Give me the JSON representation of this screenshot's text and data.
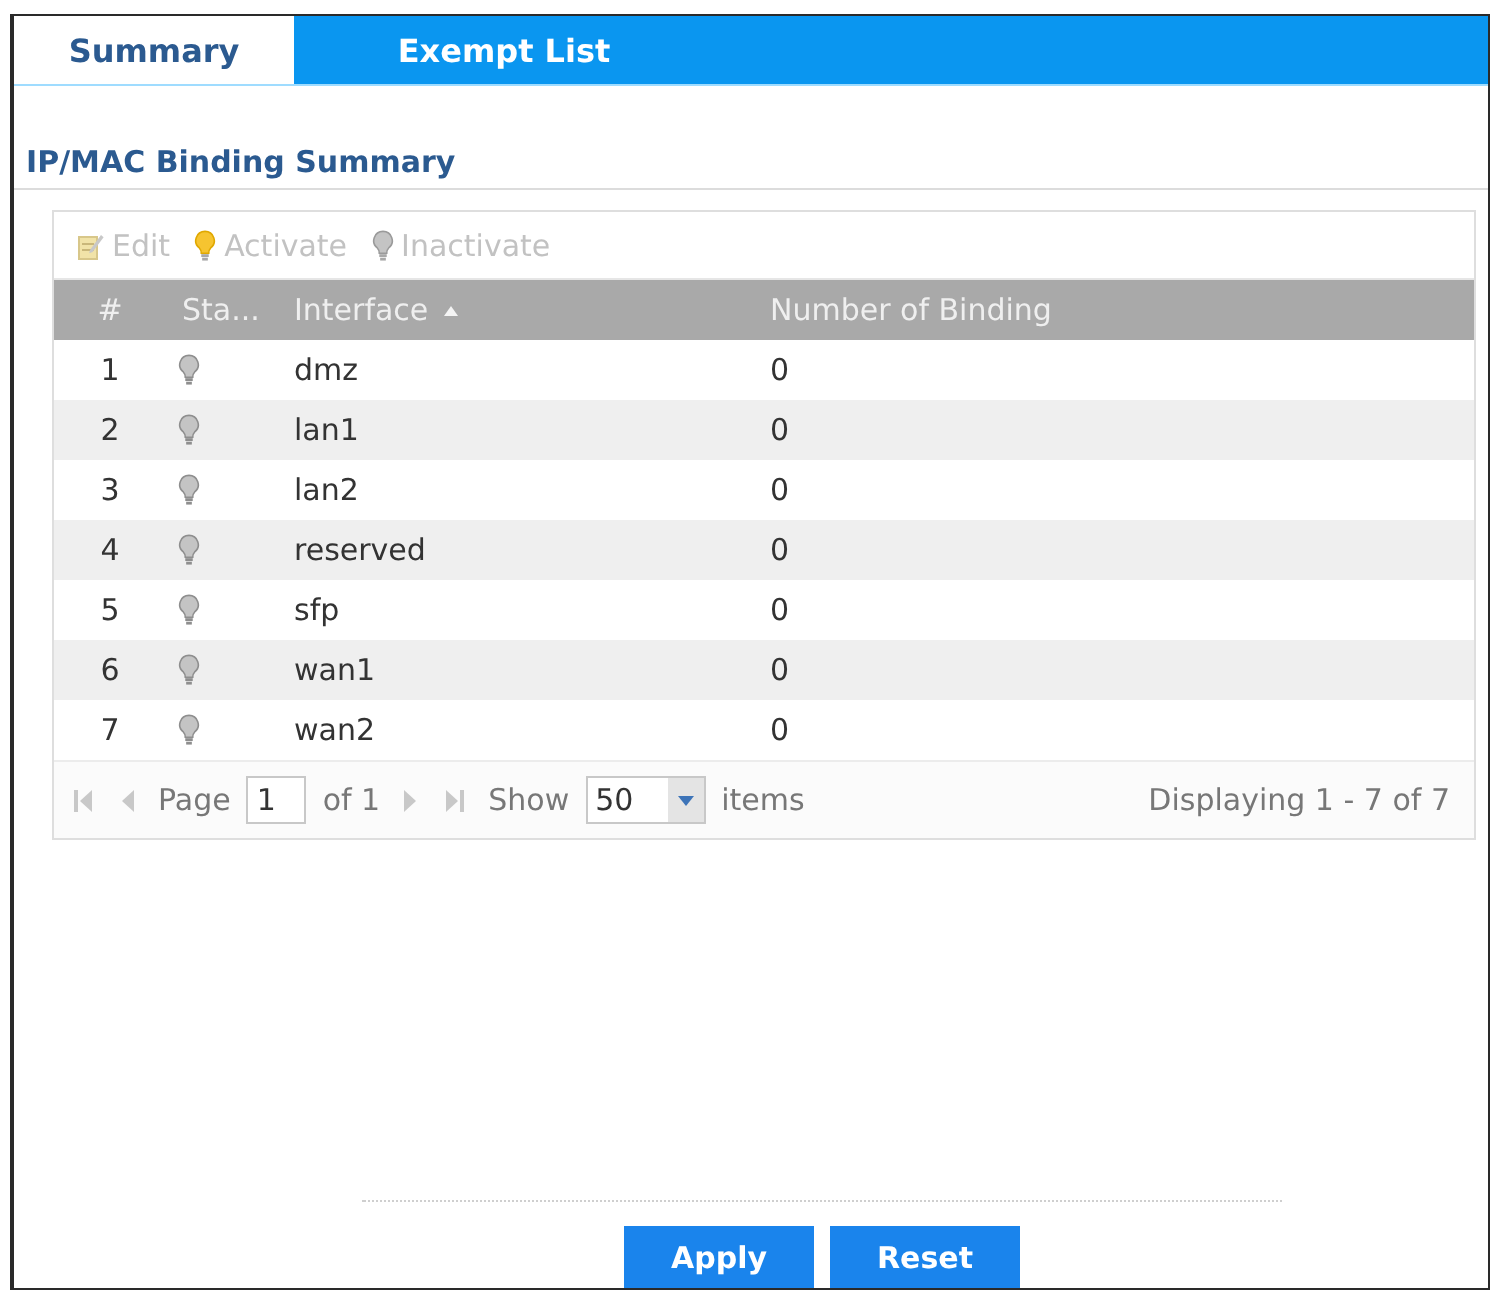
{
  "tabs": [
    {
      "label": "Summary",
      "selected": true
    },
    {
      "label": "Exempt List",
      "selected": false
    }
  ],
  "section": {
    "title": "IP/MAC Binding Summary"
  },
  "toolbar": [
    {
      "kind": "edit",
      "label": "Edit",
      "disabled": true
    },
    {
      "kind": "activate",
      "label": "Activate",
      "disabled": true
    },
    {
      "kind": "inactivate",
      "label": "Inactivate",
      "disabled": true
    }
  ],
  "table": {
    "columns": [
      {
        "label": "#",
        "sorted": false
      },
      {
        "label": "Sta...",
        "sorted": false
      },
      {
        "label": "Interface",
        "sorted": true
      },
      {
        "label": "Number of Binding",
        "sorted": false
      }
    ],
    "rows": [
      {
        "number": "1",
        "active": false,
        "interface": "dmz",
        "bindings": "0"
      },
      {
        "number": "2",
        "active": false,
        "interface": "lan1",
        "bindings": "0"
      },
      {
        "number": "3",
        "active": false,
        "interface": "lan2",
        "bindings": "0"
      },
      {
        "number": "4",
        "active": false,
        "interface": "reserved",
        "bindings": "0"
      },
      {
        "number": "5",
        "active": false,
        "interface": "sfp",
        "bindings": "0"
      },
      {
        "number": "6",
        "active": false,
        "interface": "wan1",
        "bindings": "0"
      },
      {
        "number": "7",
        "active": false,
        "interface": "wan2",
        "bindings": "0"
      }
    ]
  },
  "pagination": {
    "page_label": "Page",
    "page": "1",
    "total": "of 1",
    "show_label": "Show",
    "page_size": "50",
    "items_label": "items",
    "summary": "Displaying 1 - 7 of 7"
  },
  "buttons": [
    {
      "label": "Apply"
    },
    {
      "label": "Reset"
    }
  ]
}
